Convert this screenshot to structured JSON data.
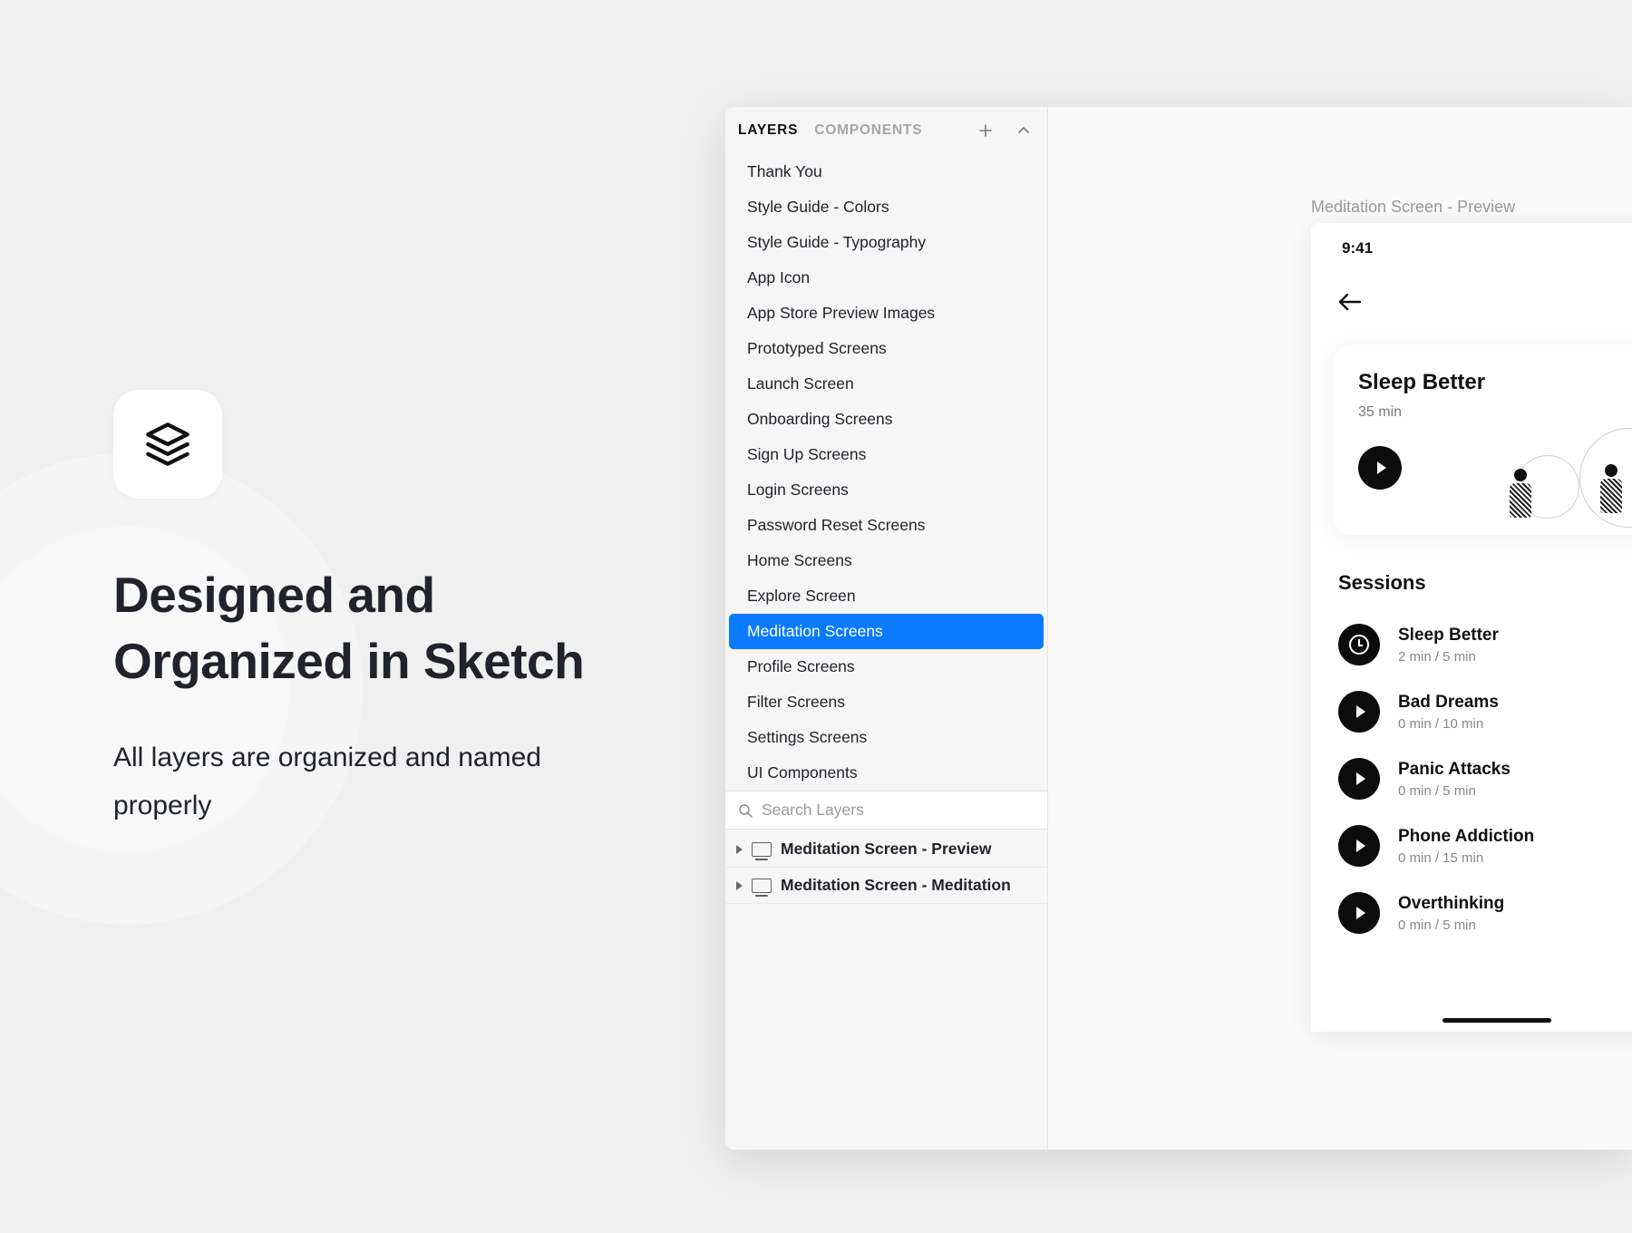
{
  "left": {
    "heading_line1": "Designed and",
    "heading_line2": "Organized in Sketch",
    "subtext": "All layers are organized and named properly"
  },
  "sidebar": {
    "tabs": {
      "layers": "LAYERS",
      "components": "COMPONENTS"
    },
    "items": [
      "Thank You",
      "Style Guide - Colors",
      "Style Guide - Typography",
      "App Icon",
      "App Store Preview Images",
      "Prototyped Screens",
      "Launch Screen",
      "Onboarding Screens",
      "Sign Up Screens",
      "Login Screens",
      "Password Reset Screens",
      "Home Screens",
      "Explore Screen",
      "Meditation Screens",
      "Profile Screens",
      "Filter Screens",
      "Settings Screens",
      "UI Components"
    ],
    "selected_index": 13,
    "search_placeholder": "Search Layers",
    "artboards": [
      "Meditation Screen - Preview",
      "Meditation Screen - Meditation"
    ]
  },
  "canvas": {
    "artboard_title": "Meditation Screen - Preview",
    "status_time": "9:41",
    "card": {
      "title": "Sleep Better",
      "subtitle": "35 min"
    },
    "sessions_heading": "Sessions",
    "sessions": [
      {
        "title": "Sleep Better",
        "sub": "2 min / 5 min",
        "icon": "clock"
      },
      {
        "title": "Bad Dreams",
        "sub": "0 min / 10 min",
        "icon": "play"
      },
      {
        "title": "Panic Attacks",
        "sub": "0 min / 5 min",
        "icon": "play"
      },
      {
        "title": "Phone Addiction",
        "sub": "0 min / 15 min",
        "icon": "play"
      },
      {
        "title": "Overthinking",
        "sub": "0 min / 5 min",
        "icon": "play"
      }
    ]
  }
}
